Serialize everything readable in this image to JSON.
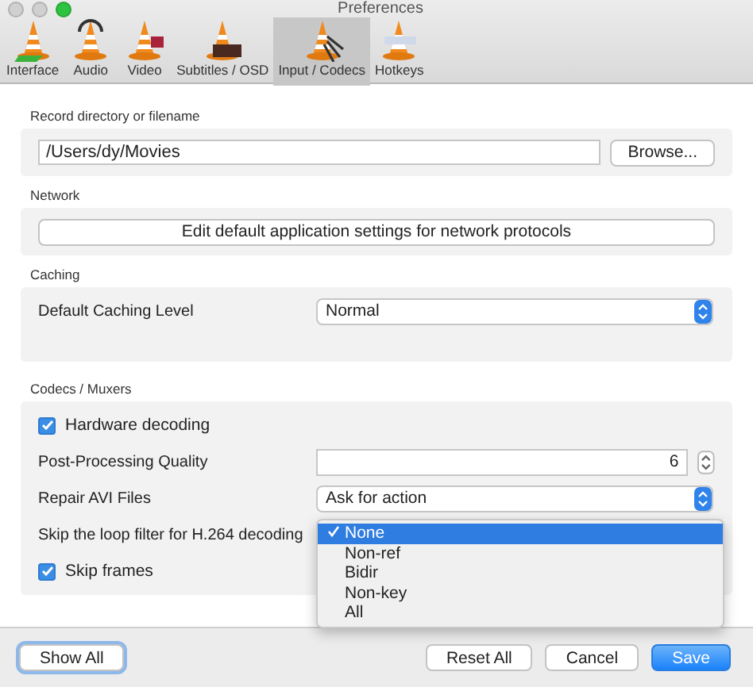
{
  "window": {
    "title": "Preferences"
  },
  "tabs": [
    {
      "label": "Interface",
      "selected": false
    },
    {
      "label": "Audio",
      "selected": false
    },
    {
      "label": "Video",
      "selected": false
    },
    {
      "label": "Subtitles / OSD",
      "selected": false
    },
    {
      "label": "Input / Codecs",
      "selected": true
    },
    {
      "label": "Hotkeys",
      "selected": false
    }
  ],
  "record": {
    "label": "Record directory or filename",
    "path": "/Users/dy/Movies",
    "button": "Browse..."
  },
  "network": {
    "label": "Network",
    "button": "Edit default application settings for network protocols"
  },
  "caching": {
    "label": "Caching",
    "setting": "Default Caching Level",
    "value": "Normal"
  },
  "codecs": {
    "label": "Codecs / Muxers",
    "rows": [
      {
        "kind": "checkbox",
        "label": "Hardware decoding",
        "checked": true
      },
      {
        "kind": "number",
        "label": "Post-Processing Quality",
        "value": "6"
      },
      {
        "kind": "select",
        "label": "Repair AVI Files",
        "value": "Ask for action"
      },
      {
        "kind": "menu",
        "label": "Skip the loop filter for H.264 decoding",
        "options": [
          {
            "label": "None",
            "selected": true
          },
          {
            "label": "Non-ref",
            "selected": false
          },
          {
            "label": "Bidir",
            "selected": false
          },
          {
            "label": "Non-key",
            "selected": false
          },
          {
            "label": "All",
            "selected": false
          }
        ]
      },
      {
        "kind": "checkbox",
        "label": "Skip frames",
        "checked": true
      }
    ]
  },
  "buttons": [
    {
      "label": "Show All",
      "kind": "focused"
    },
    {
      "label": "Reset All",
      "kind": "normal"
    },
    {
      "label": "Cancel",
      "kind": "normal"
    },
    {
      "label": "Save",
      "kind": "default"
    }
  ]
}
